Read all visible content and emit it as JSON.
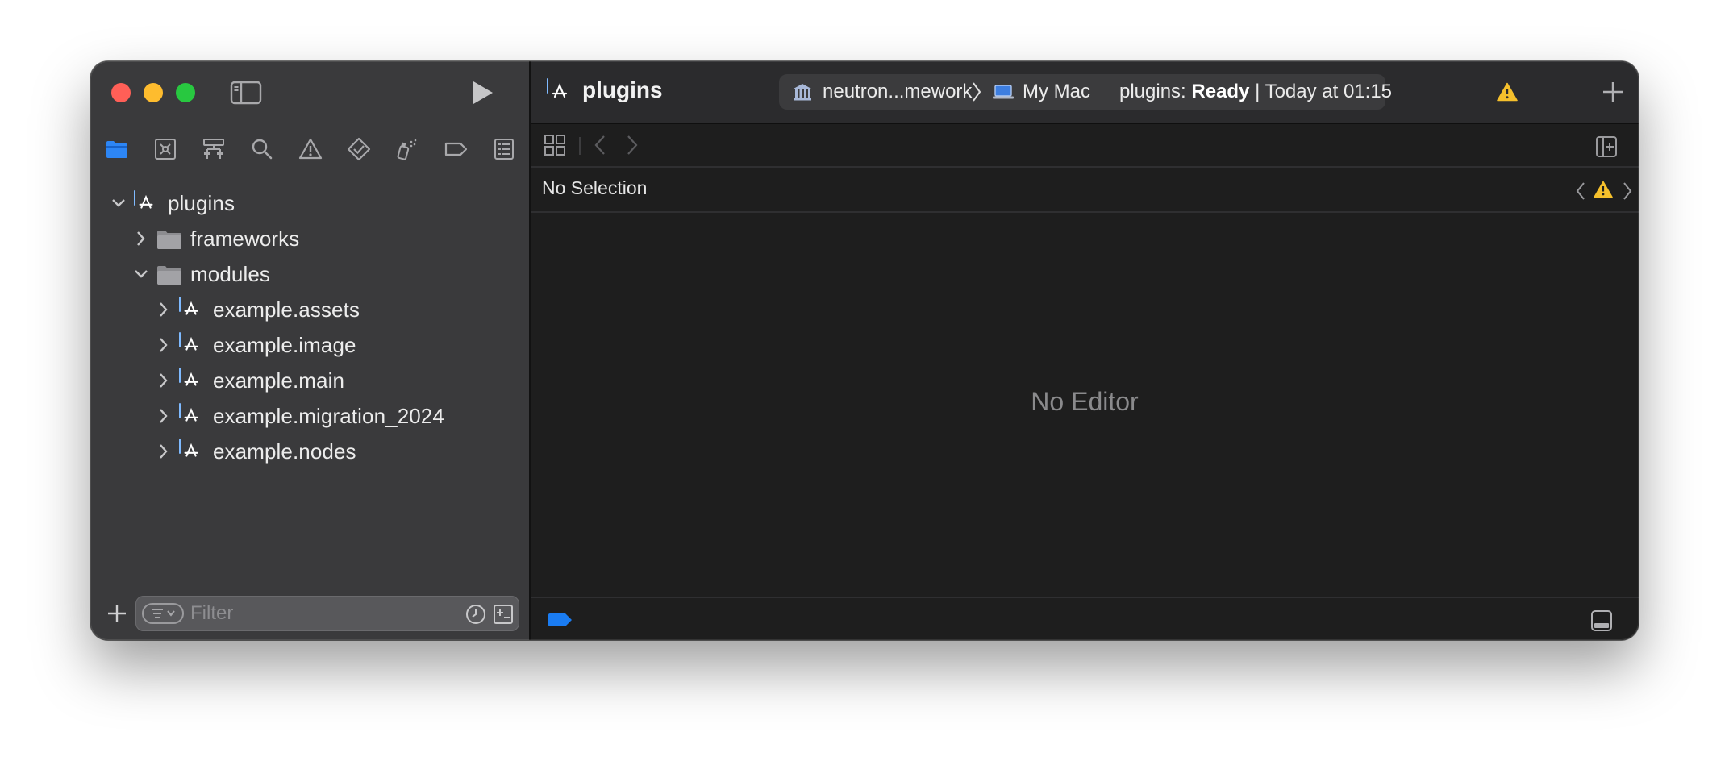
{
  "window": {
    "traffic_lights": [
      "close",
      "minimize",
      "zoom"
    ]
  },
  "sidebar": {
    "toolbar": {
      "toggle_icon": "sidebar-toggle-icon",
      "run_icon": "run-play-icon"
    },
    "navigator_tabs": [
      {
        "name": "project-navigator",
        "icon": "folder-icon",
        "active": true
      },
      {
        "name": "source-control-navigator",
        "icon": "source-control-icon"
      },
      {
        "name": "symbol-navigator",
        "icon": "hierarchy-icon"
      },
      {
        "name": "find-navigator",
        "icon": "search-icon"
      },
      {
        "name": "issue-navigator",
        "icon": "warning-icon"
      },
      {
        "name": "test-navigator",
        "icon": "test-diamond-icon"
      },
      {
        "name": "debug-navigator",
        "icon": "spray-can-icon"
      },
      {
        "name": "breakpoint-navigator",
        "icon": "breakpoint-icon"
      },
      {
        "name": "report-navigator",
        "icon": "report-list-icon"
      }
    ],
    "tree": {
      "root": {
        "label": "plugins",
        "expanded": true
      },
      "frameworks": {
        "label": "frameworks",
        "expanded": false
      },
      "modules": {
        "label": "modules",
        "expanded": true
      },
      "modules_children": [
        {
          "label": "example.assets"
        },
        {
          "label": "example.image"
        },
        {
          "label": "example.main"
        },
        {
          "label": "example.migration_2024"
        },
        {
          "label": "example.nodes"
        }
      ]
    },
    "filter": {
      "placeholder": "Filter"
    }
  },
  "main": {
    "title": "plugins",
    "status_bar": {
      "scheme": "neutron...mework",
      "destination": "My Mac",
      "status_prefix": "plugins: ",
      "status_state": "Ready",
      "status_time": " | Today at 01:15"
    },
    "jump_bar": {
      "text": "No Selection"
    },
    "editor": {
      "empty_text": "No Editor"
    }
  },
  "colors": {
    "accent": "#1a7cf2",
    "warning": "#f5c02c",
    "sidebar_bg": "#3a3a3c",
    "editor_bg": "#1e1e1e",
    "close": "#ff5f57",
    "minimize": "#febc2e",
    "zoom": "#28c840"
  }
}
